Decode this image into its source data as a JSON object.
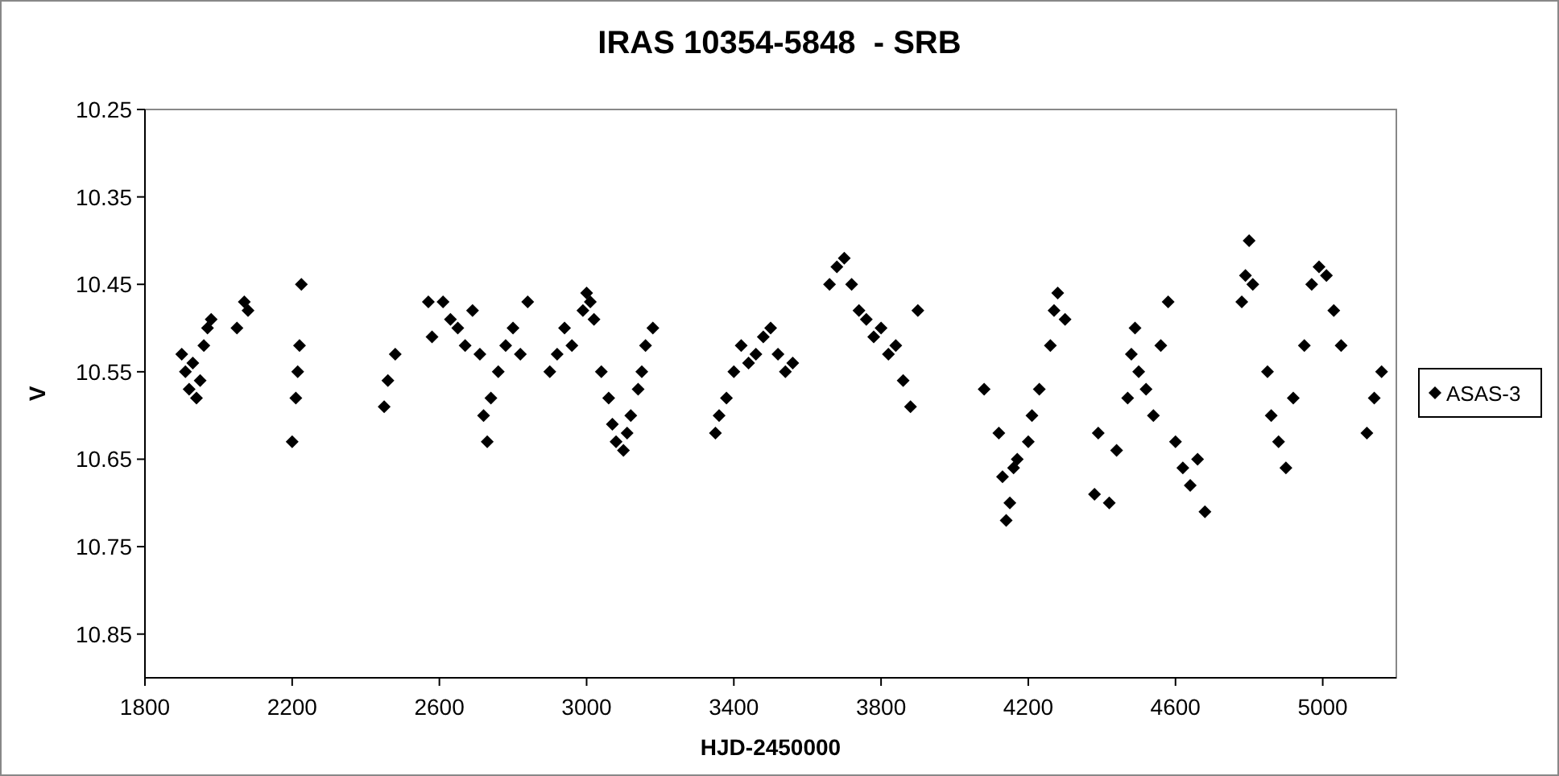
{
  "chart": {
    "chart_data": {
      "type": "scatter",
      "title": "IRAS 10354-5848  - SRB",
      "xlabel": "HJD-2450000",
      "ylabel": "V",
      "xlim": [
        1800,
        5200
      ],
      "ylim": [
        10.9,
        10.25
      ],
      "xticks": [
        1800,
        2200,
        2600,
        3000,
        3400,
        3800,
        4200,
        4600,
        5000
      ],
      "yticks": [
        {
          "value": 10.25,
          "label": "10.25"
        },
        {
          "value": 10.35,
          "label": "10.35"
        },
        {
          "value": 10.45,
          "label": "10.45"
        },
        {
          "value": 10.55,
          "label": "10.55"
        },
        {
          "value": 10.65,
          "label": "10.65"
        },
        {
          "value": 10.75,
          "label": "10.75"
        },
        {
          "value": 10.85,
          "label": "10.85"
        }
      ],
      "x": [
        1900,
        1910,
        1920,
        1930,
        1940,
        1950,
        1960,
        1970,
        1980,
        2050,
        2070,
        2080,
        2200,
        2210,
        2215,
        2220,
        2225,
        2450,
        2460,
        2480,
        2570,
        2580,
        2610,
        2630,
        2650,
        2670,
        2690,
        2710,
        2720,
        2730,
        2740,
        2760,
        2780,
        2800,
        2820,
        2840,
        2900,
        2920,
        2940,
        2960,
        2990,
        3000,
        3010,
        3020,
        3040,
        3060,
        3070,
        3080,
        3100,
        3110,
        3120,
        3140,
        3150,
        3160,
        3180,
        3350,
        3360,
        3380,
        3400,
        3420,
        3440,
        3460,
        3480,
        3500,
        3520,
        3540,
        3560,
        3660,
        3680,
        3700,
        3720,
        3740,
        3760,
        3780,
        3800,
        3820,
        3840,
        3860,
        3880,
        3900,
        4080,
        4120,
        4130,
        4140,
        4150,
        4160,
        4170,
        4200,
        4210,
        4230,
        4260,
        4270,
        4280,
        4300,
        4380,
        4390,
        4420,
        4440,
        4470,
        4480,
        4490,
        4500,
        4520,
        4540,
        4560,
        4580,
        4600,
        4620,
        4640,
        4660,
        4680,
        4780,
        4790,
        4800,
        4810,
        4850,
        4860,
        4880,
        4900,
        4920,
        4950,
        4970,
        4990,
        5010,
        5030,
        5050,
        5120,
        5140,
        5160
      ],
      "series": [
        {
          "name": "ASAS-3",
          "color": "#000000",
          "values": [
            10.53,
            10.55,
            10.57,
            10.54,
            10.58,
            10.56,
            10.52,
            10.5,
            10.49,
            10.5,
            10.47,
            10.48,
            10.63,
            10.58,
            10.55,
            10.52,
            10.45,
            10.59,
            10.56,
            10.53,
            10.47,
            10.51,
            10.47,
            10.49,
            10.5,
            10.52,
            10.48,
            10.53,
            10.6,
            10.63,
            10.58,
            10.55,
            10.52,
            10.5,
            10.53,
            10.47,
            10.55,
            10.53,
            10.5,
            10.52,
            10.48,
            10.46,
            10.47,
            10.49,
            10.55,
            10.58,
            10.61,
            10.63,
            10.64,
            10.62,
            10.6,
            10.57,
            10.55,
            10.52,
            10.5,
            10.62,
            10.6,
            10.58,
            10.55,
            10.52,
            10.54,
            10.53,
            10.51,
            10.5,
            10.53,
            10.55,
            10.54,
            10.45,
            10.43,
            10.42,
            10.45,
            10.48,
            10.49,
            10.51,
            10.5,
            10.53,
            10.52,
            10.56,
            10.59,
            10.48,
            10.57,
            10.62,
            10.67,
            10.72,
            10.7,
            10.66,
            10.65,
            10.63,
            10.6,
            10.57,
            10.52,
            10.48,
            10.46,
            10.49,
            10.69,
            10.62,
            10.7,
            10.64,
            10.58,
            10.53,
            10.5,
            10.55,
            10.57,
            10.6,
            10.52,
            10.47,
            10.63,
            10.66,
            10.68,
            10.65,
            10.71,
            10.47,
            10.44,
            10.4,
            10.45,
            10.55,
            10.6,
            10.63,
            10.66,
            10.58,
            10.52,
            10.45,
            10.43,
            10.44,
            10.48,
            10.52,
            10.62,
            10.58,
            10.55
          ]
        }
      ]
    }
  }
}
